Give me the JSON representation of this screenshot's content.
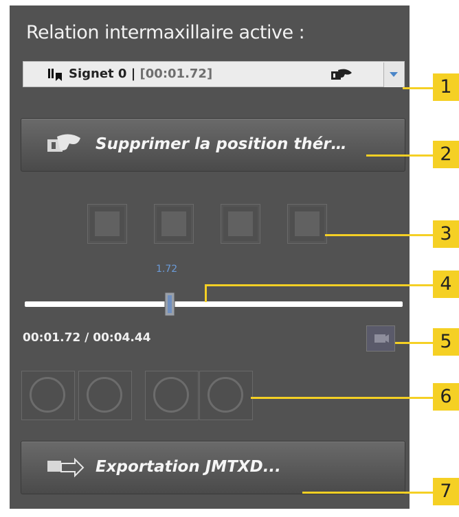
{
  "panel": {
    "title": "Relation intermaxillaire active :"
  },
  "dropdown": {
    "bookmark": "Signet 0",
    "separator": " | ",
    "timestamp": "[00:01.72]"
  },
  "buttons": {
    "delete_label": "Supprimer la position thér…",
    "export_label": "Exportation JMTXD..."
  },
  "slider": {
    "value_label": "1.72",
    "position": 0.387
  },
  "time": {
    "current_total": "00:01.72 / 00:04.44"
  },
  "callouts": [
    "1",
    "2",
    "3",
    "4",
    "5",
    "6",
    "7"
  ],
  "icons": {
    "bookmark": "bookmark-icon",
    "jaw_motion": "jaw-motion-icon",
    "play": "play-icon",
    "stop": "stop-icon",
    "prev": "previous-icon",
    "next": "next-icon"
  },
  "colors": {
    "panel_bg": "#525252",
    "callout": "#f5d024",
    "accent": "#4a86c8"
  }
}
